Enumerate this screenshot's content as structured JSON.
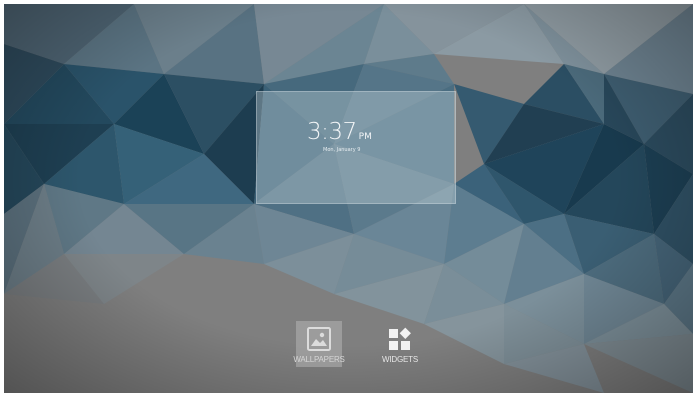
{
  "lock_clock": {
    "time": "3:37",
    "ampm": "PM",
    "date": "Mon, January 9"
  },
  "options": {
    "wallpapers": {
      "label": "WALLPAPERS",
      "icon": "image-icon",
      "selected": true
    },
    "widgets": {
      "label": "WIDGETS",
      "icon": "widgets-icon",
      "selected": false
    }
  },
  "colors": {
    "background_gray": "#7d7d7d",
    "wallpaper_dark": "#1f3b4d",
    "wallpaper_mid": "#3d5f73",
    "wallpaper_light": "#6f8a99",
    "label_text": "#e6e6e6"
  }
}
